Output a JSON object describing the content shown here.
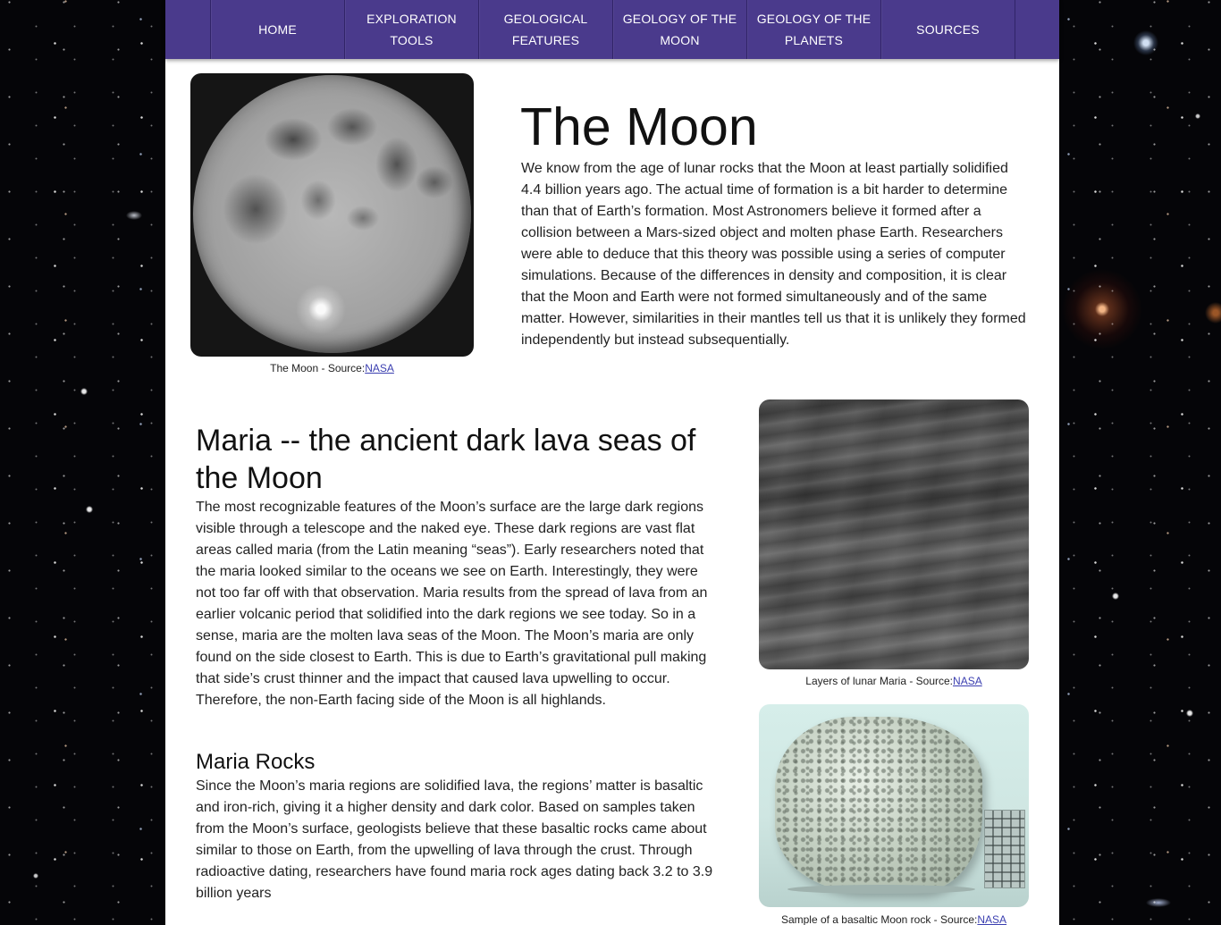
{
  "nav": {
    "items": [
      {
        "label": "HOME"
      },
      {
        "label": "EXPLORATION TOOLS"
      },
      {
        "label": "GEOLOGICAL FEATURES"
      },
      {
        "label": "GEOLOGY OF THE MOON"
      },
      {
        "label": "GEOLOGY OF THE PLANETS"
      },
      {
        "label": "SOURCES"
      }
    ]
  },
  "intro": {
    "title": "The Moon",
    "body": "We know from the age of lunar rocks that the Moon at least partially solidified 4.4 billion years ago. The actual time of formation is a bit harder to determine than that of Earth’s formation. Most Astronomers believe it formed after a collision between a Mars-sized object and molten phase Earth. Researchers were able to deduce that this theory was possible using a series of computer simulations. Because of the differences in density and composition, it is clear that the Moon and Earth were not formed simultaneously and of the same matter. However, similarities in their mantles tell us that it is unlikely they formed independently but instead subsequentially.",
    "image_caption": "The Moon - Source:",
    "image_caption_link": "NASA"
  },
  "maria": {
    "title": "Maria -- the ancient dark lava seas of the Moon",
    "body": "The most recognizable features of the Moon’s surface are the large dark regions visible through a telescope and the naked eye. These dark regions are vast flat areas called maria (from the Latin meaning “seas”). Early researchers noted that the maria looked similar to the oceans we see on Earth. Interestingly, they were not too far off with that observation. Maria results from the spread of lava from an earlier volcanic period that solidified into the dark regions we see today. So in a sense, maria are the molten lava seas of the Moon. The Moon’s maria are only found on the side closest to Earth. This is due to Earth’s gravitational pull making that side’s crust thinner and the impact that caused lava upwelling to occur. Therefore, the non-Earth facing side of the Moon is all highlands.",
    "image_caption": "Layers of lunar Maria - Source:",
    "image_caption_link": "NASA"
  },
  "maria_rocks": {
    "title": "Maria Rocks",
    "body": "Since the Moon’s maria regions are solidified lava, the regions’ matter is basaltic and iron-rich, giving it a higher density and dark color. Based on samples taken from the Moon’s surface, geologists believe that these basaltic rocks came about similar to those on Earth, from the upwelling of lava through the crust. Through radioactive dating, researchers have found maria rock ages dating back 3.2 to 3.9 billion years",
    "image_caption": "Sample of a basaltic Moon rock - Source:",
    "image_caption_link": "NASA"
  },
  "colors": {
    "nav_background": "#4a3a8c",
    "page_background": "#ffffff",
    "link": "#3b3fb0"
  }
}
